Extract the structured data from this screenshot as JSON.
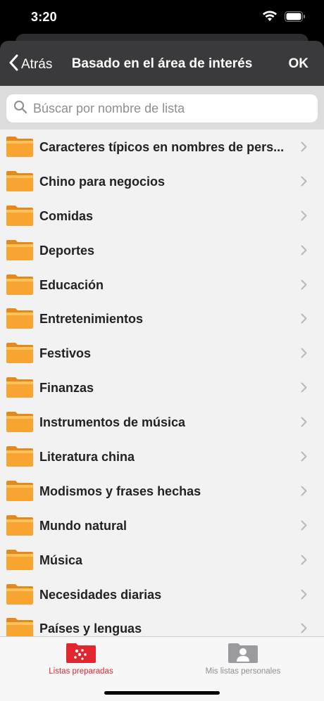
{
  "status": {
    "time": "3:20"
  },
  "nav": {
    "back_label": "Atrás",
    "title": "Basado en el área de interés",
    "ok_label": "OK"
  },
  "search": {
    "placeholder": "Búscar por nombre de lista",
    "value": ""
  },
  "list": {
    "items": [
      {
        "label": "Caracteres típicos en nombres de pers..."
      },
      {
        "label": "Chino para negocios"
      },
      {
        "label": "Comidas"
      },
      {
        "label": "Deportes"
      },
      {
        "label": "Educación"
      },
      {
        "label": "Entretenimientos"
      },
      {
        "label": "Festivos"
      },
      {
        "label": "Finanzas"
      },
      {
        "label": "Instrumentos de música"
      },
      {
        "label": "Literatura china"
      },
      {
        "label": "Modismos y frases hechas"
      },
      {
        "label": "Mundo natural"
      },
      {
        "label": "Música"
      },
      {
        "label": "Necesidades diarias"
      },
      {
        "label": "Países y lenguas"
      }
    ]
  },
  "tabs": [
    {
      "label": "Listas preparadas",
      "icon": "prepared-lists-icon",
      "active": true
    },
    {
      "label": "Mis listas personales",
      "icon": "personal-lists-icon",
      "active": false
    }
  ],
  "colors": {
    "accent": "#e1262d",
    "folder": "#f7a530",
    "nav_bg": "#3a3a3c"
  }
}
